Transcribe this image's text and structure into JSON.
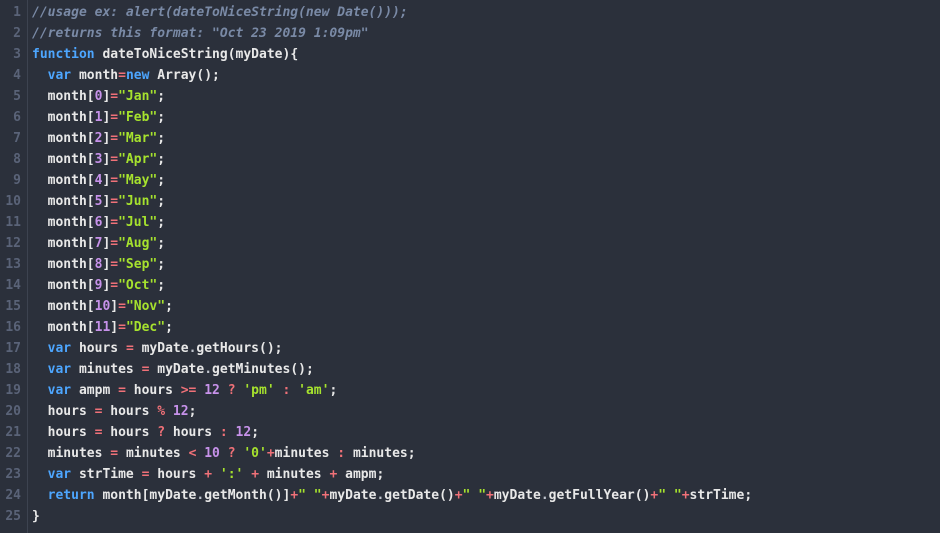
{
  "editor": {
    "total_lines": 25,
    "language": "javascript",
    "lines": [
      {
        "n": 1,
        "tokens": [
          [
            "//usage ex: alert(dateToNiceString(new Date()));",
            "comment"
          ]
        ]
      },
      {
        "n": 2,
        "tokens": [
          [
            "//returns this format: \"Oct 23 2019 1:09pm\"",
            "comment"
          ]
        ]
      },
      {
        "n": 3,
        "tokens": [
          [
            "function",
            "keyword"
          ],
          [
            " ",
            "plain"
          ],
          [
            "dateToNiceString",
            "def"
          ],
          [
            "(",
            "paren"
          ],
          [
            "myDate",
            "var"
          ],
          [
            ")",
            "paren"
          ],
          [
            "{",
            "paren"
          ]
        ]
      },
      {
        "n": 4,
        "tokens": [
          [
            "  ",
            "plain"
          ],
          [
            "var",
            "keyword"
          ],
          [
            " ",
            "plain"
          ],
          [
            "month",
            "var"
          ],
          [
            "=",
            "op"
          ],
          [
            "new",
            "keyword2"
          ],
          [
            " ",
            "plain"
          ],
          [
            "Array",
            "func"
          ],
          [
            "()",
            "paren"
          ],
          [
            ";",
            "semi"
          ]
        ]
      },
      {
        "n": 5,
        "tokens": [
          [
            "  ",
            "plain"
          ],
          [
            "month",
            "var"
          ],
          [
            "[",
            "paren"
          ],
          [
            "0",
            "number"
          ],
          [
            "]",
            "paren"
          ],
          [
            "=",
            "op"
          ],
          [
            "\"Jan\"",
            "string"
          ],
          [
            ";",
            "semi"
          ]
        ]
      },
      {
        "n": 6,
        "tokens": [
          [
            "  ",
            "plain"
          ],
          [
            "month",
            "var"
          ],
          [
            "[",
            "paren"
          ],
          [
            "1",
            "number"
          ],
          [
            "]",
            "paren"
          ],
          [
            "=",
            "op"
          ],
          [
            "\"Feb\"",
            "string"
          ],
          [
            ";",
            "semi"
          ]
        ]
      },
      {
        "n": 7,
        "tokens": [
          [
            "  ",
            "plain"
          ],
          [
            "month",
            "var"
          ],
          [
            "[",
            "paren"
          ],
          [
            "2",
            "number"
          ],
          [
            "]",
            "paren"
          ],
          [
            "=",
            "op"
          ],
          [
            "\"Mar\"",
            "string"
          ],
          [
            ";",
            "semi"
          ]
        ]
      },
      {
        "n": 8,
        "tokens": [
          [
            "  ",
            "plain"
          ],
          [
            "month",
            "var"
          ],
          [
            "[",
            "paren"
          ],
          [
            "3",
            "number"
          ],
          [
            "]",
            "paren"
          ],
          [
            "=",
            "op"
          ],
          [
            "\"Apr\"",
            "string"
          ],
          [
            ";",
            "semi"
          ]
        ]
      },
      {
        "n": 9,
        "tokens": [
          [
            "  ",
            "plain"
          ],
          [
            "month",
            "var"
          ],
          [
            "[",
            "paren"
          ],
          [
            "4",
            "number"
          ],
          [
            "]",
            "paren"
          ],
          [
            "=",
            "op"
          ],
          [
            "\"May\"",
            "string"
          ],
          [
            ";",
            "semi"
          ]
        ]
      },
      {
        "n": 10,
        "tokens": [
          [
            "  ",
            "plain"
          ],
          [
            "month",
            "var"
          ],
          [
            "[",
            "paren"
          ],
          [
            "5",
            "number"
          ],
          [
            "]",
            "paren"
          ],
          [
            "=",
            "op"
          ],
          [
            "\"Jun\"",
            "string"
          ],
          [
            ";",
            "semi"
          ]
        ]
      },
      {
        "n": 11,
        "tokens": [
          [
            "  ",
            "plain"
          ],
          [
            "month",
            "var"
          ],
          [
            "[",
            "paren"
          ],
          [
            "6",
            "number"
          ],
          [
            "]",
            "paren"
          ],
          [
            "=",
            "op"
          ],
          [
            "\"Jul\"",
            "string"
          ],
          [
            ";",
            "semi"
          ]
        ]
      },
      {
        "n": 12,
        "tokens": [
          [
            "  ",
            "plain"
          ],
          [
            "month",
            "var"
          ],
          [
            "[",
            "paren"
          ],
          [
            "7",
            "number"
          ],
          [
            "]",
            "paren"
          ],
          [
            "=",
            "op"
          ],
          [
            "\"Aug\"",
            "string"
          ],
          [
            ";",
            "semi"
          ]
        ]
      },
      {
        "n": 13,
        "tokens": [
          [
            "  ",
            "plain"
          ],
          [
            "month",
            "var"
          ],
          [
            "[",
            "paren"
          ],
          [
            "8",
            "number"
          ],
          [
            "]",
            "paren"
          ],
          [
            "=",
            "op"
          ],
          [
            "\"Sep\"",
            "string"
          ],
          [
            ";",
            "semi"
          ]
        ]
      },
      {
        "n": 14,
        "tokens": [
          [
            "  ",
            "plain"
          ],
          [
            "month",
            "var"
          ],
          [
            "[",
            "paren"
          ],
          [
            "9",
            "number"
          ],
          [
            "]",
            "paren"
          ],
          [
            "=",
            "op"
          ],
          [
            "\"Oct\"",
            "string"
          ],
          [
            ";",
            "semi"
          ]
        ]
      },
      {
        "n": 15,
        "tokens": [
          [
            "  ",
            "plain"
          ],
          [
            "month",
            "var"
          ],
          [
            "[",
            "paren"
          ],
          [
            "10",
            "number"
          ],
          [
            "]",
            "paren"
          ],
          [
            "=",
            "op"
          ],
          [
            "\"Nov\"",
            "string"
          ],
          [
            ";",
            "semi"
          ]
        ]
      },
      {
        "n": 16,
        "tokens": [
          [
            "  ",
            "plain"
          ],
          [
            "month",
            "var"
          ],
          [
            "[",
            "paren"
          ],
          [
            "11",
            "number"
          ],
          [
            "]",
            "paren"
          ],
          [
            "=",
            "op"
          ],
          [
            "\"Dec\"",
            "string"
          ],
          [
            ";",
            "semi"
          ]
        ]
      },
      {
        "n": 17,
        "tokens": [
          [
            "  ",
            "plain"
          ],
          [
            "var",
            "keyword"
          ],
          [
            " ",
            "plain"
          ],
          [
            "hours",
            "var"
          ],
          [
            " ",
            "plain"
          ],
          [
            "=",
            "op"
          ],
          [
            " ",
            "plain"
          ],
          [
            "myDate",
            "var"
          ],
          [
            ".",
            "plain"
          ],
          [
            "getHours",
            "func"
          ],
          [
            "()",
            "paren"
          ],
          [
            ";",
            "semi"
          ]
        ]
      },
      {
        "n": 18,
        "tokens": [
          [
            "  ",
            "plain"
          ],
          [
            "var",
            "keyword"
          ],
          [
            " ",
            "plain"
          ],
          [
            "minutes",
            "var"
          ],
          [
            " ",
            "plain"
          ],
          [
            "=",
            "op"
          ],
          [
            " ",
            "plain"
          ],
          [
            "myDate",
            "var"
          ],
          [
            ".",
            "plain"
          ],
          [
            "getMinutes",
            "func"
          ],
          [
            "()",
            "paren"
          ],
          [
            ";",
            "semi"
          ]
        ]
      },
      {
        "n": 19,
        "tokens": [
          [
            "  ",
            "plain"
          ],
          [
            "var",
            "keyword"
          ],
          [
            " ",
            "plain"
          ],
          [
            "ampm",
            "var"
          ],
          [
            " ",
            "plain"
          ],
          [
            "=",
            "op"
          ],
          [
            " ",
            "plain"
          ],
          [
            "hours",
            "var"
          ],
          [
            " ",
            "plain"
          ],
          [
            ">=",
            "op"
          ],
          [
            " ",
            "plain"
          ],
          [
            "12",
            "number"
          ],
          [
            " ",
            "plain"
          ],
          [
            "?",
            "op"
          ],
          [
            " ",
            "plain"
          ],
          [
            "'pm'",
            "string"
          ],
          [
            " ",
            "plain"
          ],
          [
            ":",
            "op"
          ],
          [
            " ",
            "plain"
          ],
          [
            "'am'",
            "string"
          ],
          [
            ";",
            "semi"
          ]
        ]
      },
      {
        "n": 20,
        "tokens": [
          [
            "  ",
            "plain"
          ],
          [
            "hours",
            "var"
          ],
          [
            " ",
            "plain"
          ],
          [
            "=",
            "op"
          ],
          [
            " ",
            "plain"
          ],
          [
            "hours",
            "var"
          ],
          [
            " ",
            "plain"
          ],
          [
            "%",
            "op"
          ],
          [
            " ",
            "plain"
          ],
          [
            "12",
            "number"
          ],
          [
            ";",
            "semi"
          ]
        ]
      },
      {
        "n": 21,
        "tokens": [
          [
            "  ",
            "plain"
          ],
          [
            "hours",
            "var"
          ],
          [
            " ",
            "plain"
          ],
          [
            "=",
            "op"
          ],
          [
            " ",
            "plain"
          ],
          [
            "hours",
            "var"
          ],
          [
            " ",
            "plain"
          ],
          [
            "?",
            "op"
          ],
          [
            " ",
            "plain"
          ],
          [
            "hours",
            "var"
          ],
          [
            " ",
            "plain"
          ],
          [
            ":",
            "op"
          ],
          [
            " ",
            "plain"
          ],
          [
            "12",
            "number"
          ],
          [
            ";",
            "semi"
          ]
        ]
      },
      {
        "n": 22,
        "tokens": [
          [
            "  ",
            "plain"
          ],
          [
            "minutes",
            "var"
          ],
          [
            " ",
            "plain"
          ],
          [
            "=",
            "op"
          ],
          [
            " ",
            "plain"
          ],
          [
            "minutes",
            "var"
          ],
          [
            " ",
            "plain"
          ],
          [
            "<",
            "op"
          ],
          [
            " ",
            "plain"
          ],
          [
            "10",
            "number"
          ],
          [
            " ",
            "plain"
          ],
          [
            "?",
            "op"
          ],
          [
            " ",
            "plain"
          ],
          [
            "'0'",
            "string"
          ],
          [
            "+",
            "op"
          ],
          [
            "minutes",
            "var"
          ],
          [
            " ",
            "plain"
          ],
          [
            ":",
            "op"
          ],
          [
            " ",
            "plain"
          ],
          [
            "minutes",
            "var"
          ],
          [
            ";",
            "semi"
          ]
        ]
      },
      {
        "n": 23,
        "tokens": [
          [
            "  ",
            "plain"
          ],
          [
            "var",
            "keyword"
          ],
          [
            " ",
            "plain"
          ],
          [
            "strTime",
            "var"
          ],
          [
            " ",
            "plain"
          ],
          [
            "=",
            "op"
          ],
          [
            " ",
            "plain"
          ],
          [
            "hours",
            "var"
          ],
          [
            " ",
            "plain"
          ],
          [
            "+",
            "op"
          ],
          [
            " ",
            "plain"
          ],
          [
            "':'",
            "string"
          ],
          [
            " ",
            "plain"
          ],
          [
            "+",
            "op"
          ],
          [
            " ",
            "plain"
          ],
          [
            "minutes",
            "var"
          ],
          [
            " ",
            "plain"
          ],
          [
            "+",
            "op"
          ],
          [
            " ",
            "plain"
          ],
          [
            "ampm",
            "var"
          ],
          [
            ";",
            "semi"
          ]
        ]
      },
      {
        "n": 24,
        "tokens": [
          [
            "  ",
            "plain"
          ],
          [
            "return",
            "keyword"
          ],
          [
            " ",
            "plain"
          ],
          [
            "month",
            "var"
          ],
          [
            "[",
            "paren"
          ],
          [
            "myDate",
            "var"
          ],
          [
            ".",
            "plain"
          ],
          [
            "getMonth",
            "func"
          ],
          [
            "()",
            "paren"
          ],
          [
            "]",
            "paren"
          ],
          [
            "+",
            "op"
          ],
          [
            "\" \"",
            "string"
          ],
          [
            "+",
            "op"
          ],
          [
            "myDate",
            "var"
          ],
          [
            ".",
            "plain"
          ],
          [
            "getDate",
            "func"
          ],
          [
            "()",
            "paren"
          ],
          [
            "+",
            "op"
          ],
          [
            "\" \"",
            "string"
          ],
          [
            "+",
            "op"
          ],
          [
            "myDate",
            "var"
          ],
          [
            ".",
            "plain"
          ],
          [
            "getFullYear",
            "func"
          ],
          [
            "()",
            "paren"
          ],
          [
            "+",
            "op"
          ],
          [
            "\" \"",
            "string"
          ],
          [
            "+",
            "op"
          ],
          [
            "strTime",
            "var"
          ],
          [
            ";",
            "semi"
          ]
        ]
      },
      {
        "n": 25,
        "tokens": [
          [
            "}",
            "paren"
          ]
        ]
      }
    ]
  }
}
